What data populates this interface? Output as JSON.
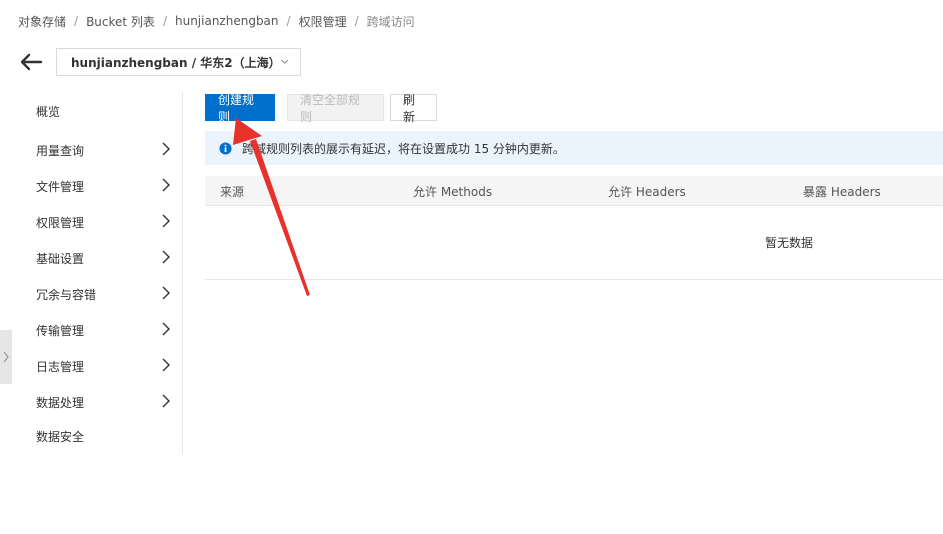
{
  "breadcrumb": {
    "items": [
      "对象存储",
      "Bucket 列表",
      "hunjianzhengban",
      "权限管理"
    ],
    "current": "跨域访问",
    "separator": "/"
  },
  "header": {
    "bucket_select": "hunjianzhengban / 华东2（上海）"
  },
  "sidebar": {
    "items": [
      {
        "label": "概览"
      },
      {
        "label": "用量查询"
      },
      {
        "label": "文件管理"
      },
      {
        "label": "权限管理"
      },
      {
        "label": "基础设置"
      },
      {
        "label": "冗余与容错"
      },
      {
        "label": "传输管理"
      },
      {
        "label": "日志管理"
      },
      {
        "label": "数据处理"
      },
      {
        "label": "数据安全"
      }
    ]
  },
  "toolbar": {
    "create_label": "创建规则",
    "clear_label": "清空全部规则",
    "refresh_label": "刷新"
  },
  "notice": {
    "text": "跨域规则列表的展示有延迟，将在设置成功 15 分钟内更新。"
  },
  "table": {
    "columns": [
      "来源",
      "允许 Methods",
      "允许 Headers",
      "暴露 Headers"
    ],
    "empty_text": "暂无数据"
  },
  "colors": {
    "primary": "#0070cc",
    "notice_bg": "#ebf4fd",
    "annotation_arrow": "#e8312b"
  }
}
